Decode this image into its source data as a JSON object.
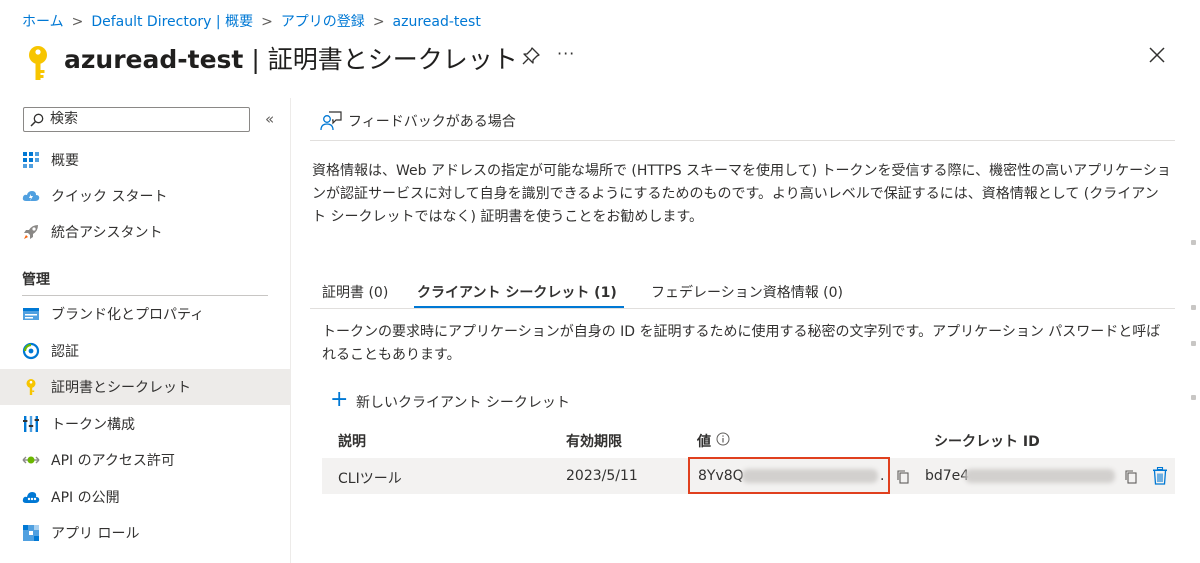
{
  "breadcrumb": [
    "ホーム",
    "Default Directory | 概要",
    "アプリの登録",
    "azuread-test"
  ],
  "title": {
    "bold": "azuread-test",
    "rest": " | 証明書とシークレット"
  },
  "more": "···",
  "search": {
    "placeholder": "検索"
  },
  "collapse": "«",
  "nav": {
    "overview": "概要",
    "quickstart": "クイック スタート",
    "assistant": "統合アシスタント",
    "manage_heading": "管理",
    "branding": "ブランド化とプロパティ",
    "auth": "認証",
    "certs": "証明書とシークレット",
    "token": "トークン構成",
    "api_perm": "API のアクセス許可",
    "api_expose": "API の公開",
    "app_roles": "アプリ ロール"
  },
  "feedback": "フィードバックがある場合",
  "description": "資格情報は、Web アドレスの指定が可能な場所で (HTTPS スキーマを使用して) トークンを受信する際に、機密性の高いアプリケーションが認証サービスに対して自身を識別できるようにするためのものです。より高いレベルで保証するには、資格情報として (クライアント シークレットではなく) 証明書を使うことをお勧めします。",
  "tabs": {
    "certs": "証明書 (0)",
    "secrets": "クライアント シークレット (1)",
    "federated": "フェデレーション資格情報 (0)"
  },
  "tab_description": "トークンの要求時にアプリケーションが自身の ID を証明するために使用する秘密の文字列です。アプリケーション パスワードと呼ばれることもあります。",
  "add_button": "新しいクライアント シークレット",
  "table": {
    "headers": {
      "description": "説明",
      "expires": "有効期限",
      "value": "値",
      "secret_id": "シークレット ID"
    },
    "rows": [
      {
        "description": "CLIツール",
        "expires": "2023/5/11",
        "value_prefix": "8Yv8Q",
        "value_suffix": ".",
        "secret_id_prefix": "bd7e4"
      }
    ]
  },
  "colors": {
    "accent": "#0078d4",
    "highlight": "#e0401e",
    "row_bg": "#f3f2f1",
    "active_nav": "#edebe9"
  }
}
